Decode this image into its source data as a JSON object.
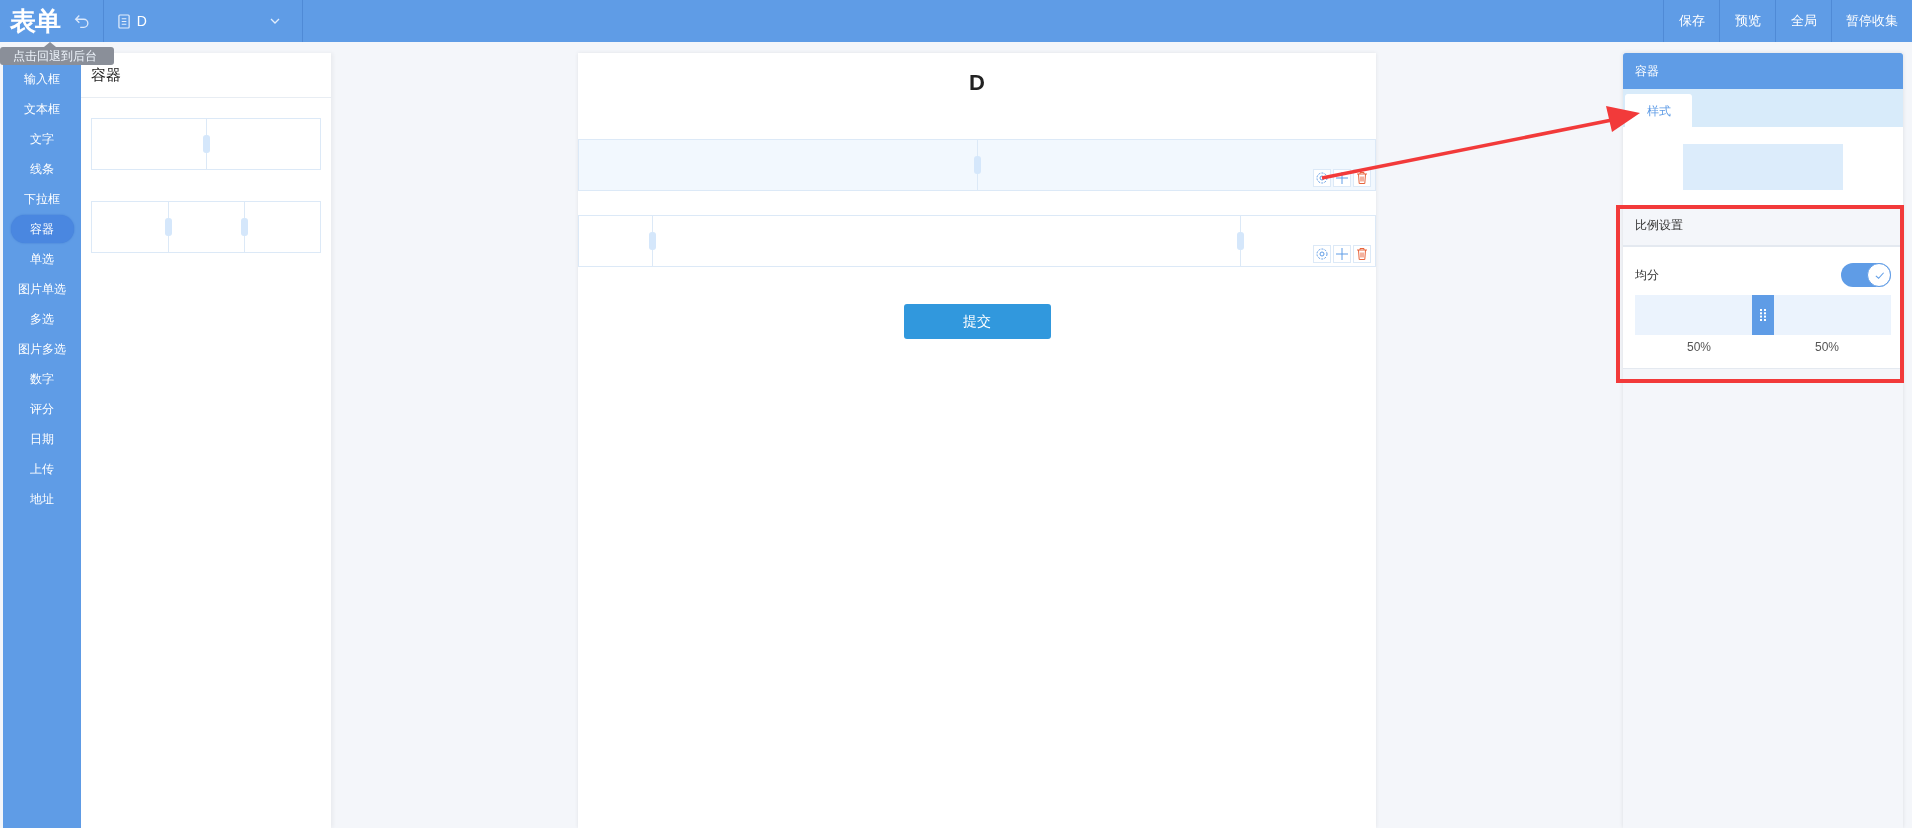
{
  "header": {
    "logo": "表单",
    "document": "D",
    "actions": [
      "保存",
      "预览",
      "全局",
      "暂停收集"
    ]
  },
  "tooltip": {
    "text": "点击回退到后台"
  },
  "sidebar": {
    "items": [
      {
        "label": "输入框",
        "selected": false
      },
      {
        "label": "文本框",
        "selected": false
      },
      {
        "label": "文字",
        "selected": false
      },
      {
        "label": "线条",
        "selected": false
      },
      {
        "label": "下拉框",
        "selected": false
      },
      {
        "label": "容器",
        "selected": true
      },
      {
        "label": "单选",
        "selected": false
      },
      {
        "label": "图片单选",
        "selected": false
      },
      {
        "label": "多选",
        "selected": false
      },
      {
        "label": "图片多选",
        "selected": false
      },
      {
        "label": "数字",
        "selected": false
      },
      {
        "label": "评分",
        "selected": false
      },
      {
        "label": "日期",
        "selected": false
      },
      {
        "label": "上传",
        "selected": false
      },
      {
        "label": "地址",
        "selected": false
      }
    ]
  },
  "components": {
    "title": "容器",
    "templates": [
      {
        "kind": "two-column"
      },
      {
        "kind": "three-column"
      }
    ]
  },
  "canvas": {
    "title": "D",
    "rows": [
      {
        "kind": "two-column",
        "selected": true
      },
      {
        "kind": "three-column-wide-middle",
        "selected": false
      }
    ],
    "submit": "提交"
  },
  "properties": {
    "title": "容器",
    "tabs": [
      {
        "label": "样式",
        "selected": true
      }
    ],
    "ratio_section": {
      "title": "比例设置",
      "equal_split": {
        "label": "均分",
        "on": true
      },
      "split": {
        "level": 0.5
      },
      "labels": [
        "50%",
        "50%"
      ]
    }
  },
  "annotations": {
    "arrow": {
      "color": "#f23a3a"
    },
    "box": {
      "color": "#f23a3a"
    }
  }
}
